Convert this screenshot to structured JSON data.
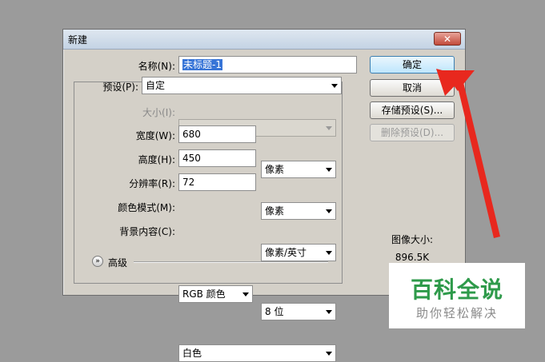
{
  "dialog": {
    "title": "新建",
    "close_label": "✕"
  },
  "form": {
    "name_label": "名称(N):",
    "name_value_selected": "未标题-1",
    "preset_label": "预设(P):",
    "preset_value": "自定",
    "size_label": "大小(I):",
    "size_value": "",
    "width_label": "宽度(W):",
    "width_value": "680",
    "width_unit": "像素",
    "height_label": "高度(H):",
    "height_value": "450",
    "height_unit": "像素",
    "resolution_label": "分辨率(R):",
    "resolution_value": "72",
    "resolution_unit": "像素/英寸",
    "color_mode_label": "颜色模式(M):",
    "color_mode_value": "RGB 颜色",
    "bit_depth_value": "8 位",
    "background_label": "背景内容(C):",
    "background_value": "白色",
    "advanced_label": "高级"
  },
  "buttons": {
    "ok": "确定",
    "cancel": "取消",
    "save_preset": "存储预设(S)...",
    "delete_preset": "删除预设(D)..."
  },
  "image_size": {
    "label": "图像大小:",
    "value": "896.5K"
  },
  "watermark": {
    "main": "百科全说",
    "sub": "助你轻松解决"
  },
  "colors": {
    "background": "#9b9b9b",
    "arrow": "#e8281e",
    "selection": "#3875d7",
    "watermark_green": "#2e9a4a"
  }
}
